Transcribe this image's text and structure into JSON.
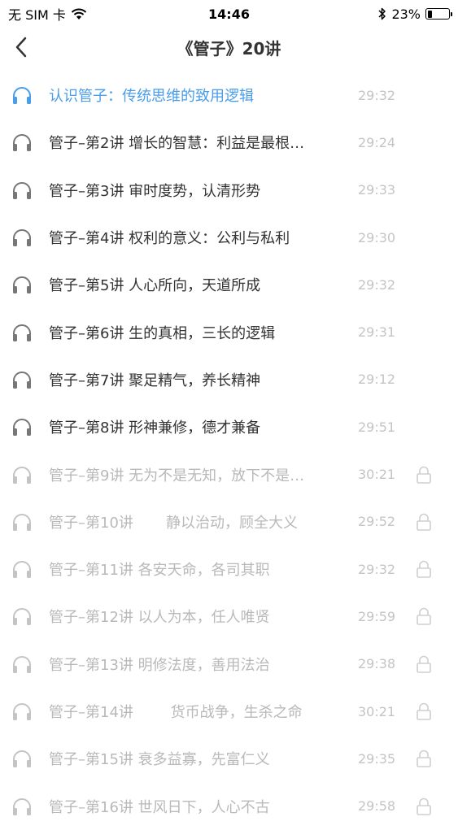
{
  "status": {
    "carrier": "无 SIM 卡",
    "time": "14:46",
    "battery": "23%",
    "battery_level": 0.23
  },
  "nav": {
    "title": "《管子》20讲"
  },
  "colors": {
    "accent": "#4a9de8",
    "text": "#333333",
    "locked_text": "#b9b9b9",
    "duration": "#c4c4c4"
  },
  "lessons": [
    {
      "title": "认识管子：传统思维的致用逻辑",
      "duration": "29:32",
      "state": "playing"
    },
    {
      "title": "管子–第2讲 增长的智慧：利益是最根…",
      "duration": "29:24",
      "state": "open"
    },
    {
      "title": "管子–第3讲 审时度势，认清形势",
      "duration": "29:33",
      "state": "open"
    },
    {
      "title": "管子–第4讲 权利的意义：公利与私利",
      "duration": "29:30",
      "state": "open"
    },
    {
      "title": "管子–第5讲 人心所向，天道所成",
      "duration": "29:32",
      "state": "open"
    },
    {
      "title": "管子–第6讲 生的真相，三长的逻辑",
      "duration": "29:31",
      "state": "open"
    },
    {
      "title": "管子–第7讲 聚足精气，养长精神",
      "duration": "29:12",
      "state": "open"
    },
    {
      "title": "管子–第8讲 形神兼修，德才兼备",
      "duration": "29:51",
      "state": "open"
    },
    {
      "title": "管子–第9讲 无为不是无知，放下不是…",
      "duration": "30:21",
      "state": "locked"
    },
    {
      "title": "管子–第10讲       静以治动，顾全大义",
      "duration": "29:52",
      "state": "locked"
    },
    {
      "title": "管子–第11讲 各安天命，各司其职",
      "duration": "29:32",
      "state": "locked"
    },
    {
      "title": "管子–第12讲 以人为本，任人唯贤",
      "duration": "29:59",
      "state": "locked"
    },
    {
      "title": "管子–第13讲 明修法度，善用法治",
      "duration": "29:38",
      "state": "locked"
    },
    {
      "title": "管子–第14讲        货币战争，生杀之命",
      "duration": "30:21",
      "state": "locked"
    },
    {
      "title": "管子–第15讲 衰多益寡，先富仁义",
      "duration": "29:35",
      "state": "locked"
    },
    {
      "title": "管子–第16讲 世风日下，人心不古",
      "duration": "29:58",
      "state": "locked"
    }
  ]
}
